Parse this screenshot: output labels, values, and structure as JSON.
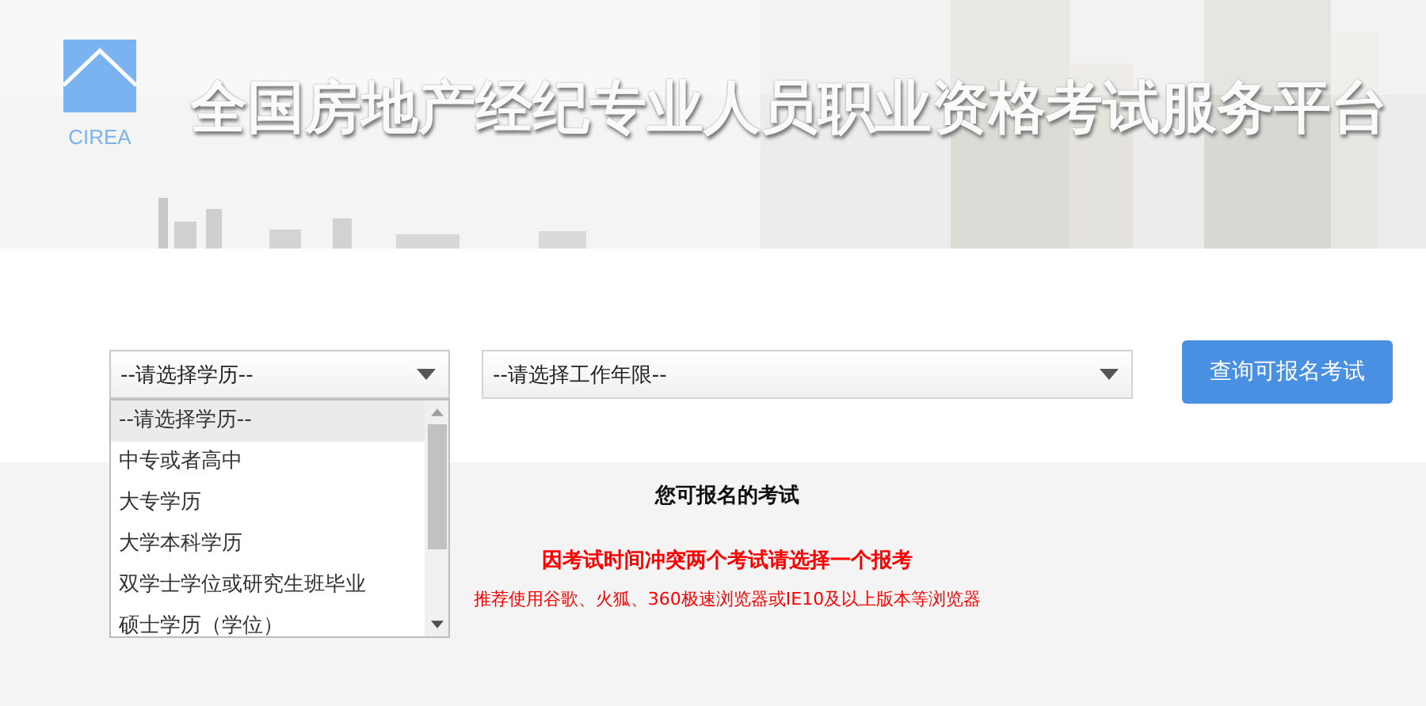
{
  "header": {
    "logo_text": "CIREA",
    "title": "全国房地产经纪专业人员职业资格考试服务平台"
  },
  "filters": {
    "education": {
      "value": "--请选择学历--",
      "expanded": true,
      "options": [
        {
          "label": "--请选择学历--",
          "selected": true
        },
        {
          "label": "中专或者高中",
          "selected": false
        },
        {
          "label": "大专学历",
          "selected": false
        },
        {
          "label": "大学本科学历",
          "selected": false
        },
        {
          "label": "双学士学位或研究生班毕业",
          "selected": false
        },
        {
          "label": "硕士学历（学位）",
          "selected": false
        }
      ]
    },
    "work_years": {
      "value": "--请选择工作年限--"
    },
    "query_button": "查询可报名考试"
  },
  "results": {
    "heading": "您可报名的考试",
    "conflict_note": "因考试时间冲突两个考试请选择一个报考",
    "browser_note": "推荐使用谷歌、火狐、360极速浏览器或IE10及以上版本等浏览器"
  }
}
